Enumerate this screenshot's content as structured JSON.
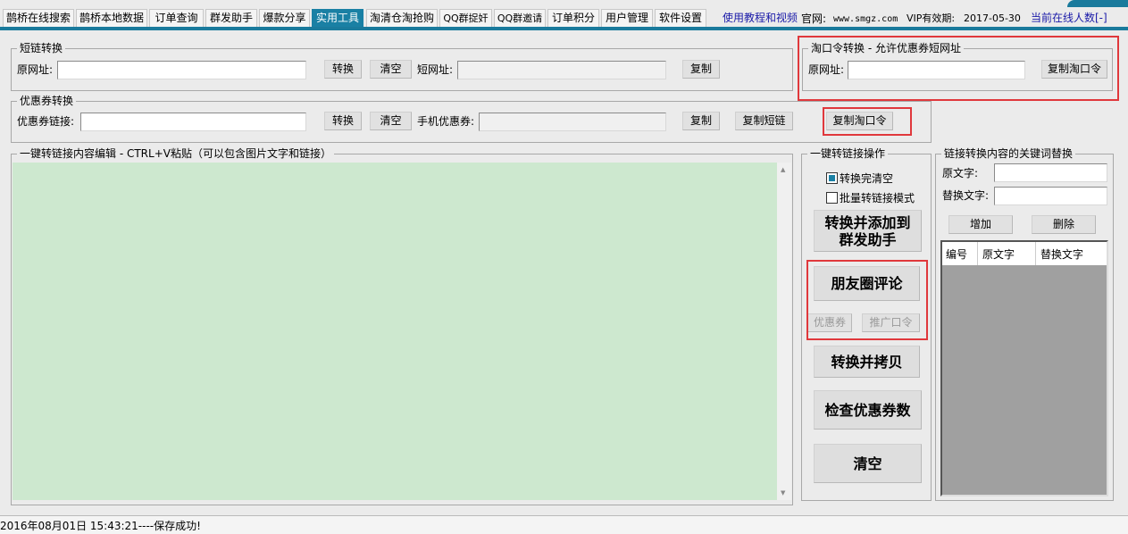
{
  "tabs": [
    "鹊桥在线搜索",
    "鹊桥本地数据",
    "订单查询",
    "群发助手",
    "爆款分享",
    "实用工具",
    "淘清仓淘抢购",
    "QQ群捉奸",
    "QQ群邀请",
    "订单积分",
    "用户管理",
    "软件设置"
  ],
  "active_tab": "实用工具",
  "header": {
    "tutorial_link": "使用教程和视频",
    "site_label": "官网:",
    "site_url": "www.smgz.com",
    "vip_label": "VIP有效期:",
    "vip_date": "2017-05-30",
    "online_users": "当前在线人数[-]"
  },
  "short_link": {
    "title": "短链转换",
    "url_label": "原网址:",
    "url_value": "",
    "convert": "转换",
    "clear": "清空",
    "short_label": "短网址:",
    "short_value": "",
    "copy": "复制"
  },
  "taokouling": {
    "title": "淘口令转换 - 允许优惠券短网址",
    "url_label": "原网址:",
    "url_value": "",
    "copy": "复制淘口令"
  },
  "coupon": {
    "title": "优惠券转换",
    "link_label": "优惠券链接:",
    "link_value": "",
    "convert": "转换",
    "clear": "清空",
    "mobile_label": "手机优惠券:",
    "mobile_value": "",
    "copy": "复制",
    "copy_short": "复制短链",
    "copy_tkl": "复制淘口令"
  },
  "editor": {
    "title": "一键转链接内容编辑  - CTRL+V粘贴（可以包含图片文字和链接）",
    "content": ""
  },
  "ops": {
    "title": "一键转链接操作",
    "clear_after": "转换完清空",
    "clear_after_checked": true,
    "batch_mode": "批量转链接模式",
    "batch_mode_checked": false,
    "add_to_group": "转换并添加到群发助手",
    "moments": "朋友圈评论",
    "coupon": "优惠券",
    "promo": "推广口令",
    "convert_copy": "转换并拷贝",
    "check_coupons": "检查优惠券数",
    "clear": "清空"
  },
  "replace": {
    "title": "链接转换内容的关键词替换",
    "orig_label": "原文字:",
    "orig_value": "",
    "repl_label": "替换文字:",
    "repl_value": "",
    "add": "增加",
    "delete": "删除",
    "columns": [
      "编号",
      "原文字",
      "替换文字"
    ]
  },
  "status": "2016年08月01日 15:43:21----保存成功!"
}
